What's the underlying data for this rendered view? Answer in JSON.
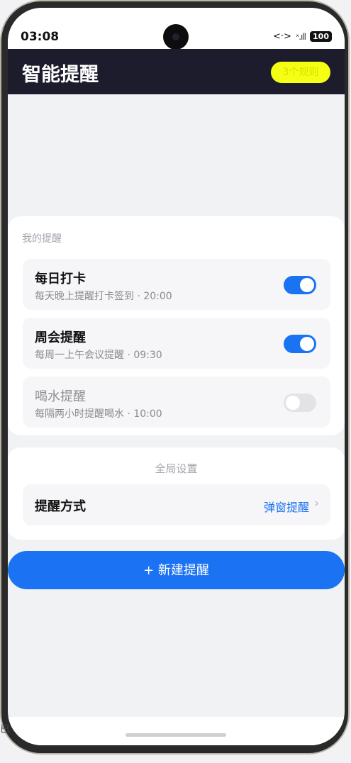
{
  "status": {
    "time": "03:08",
    "network_icon": "<·>",
    "signal": "ˣ.ıll",
    "battery": "100"
  },
  "header": {
    "title": "智能提醒",
    "rules_badge": "3个规则"
  },
  "reminders": {
    "section_label": "我的提醒",
    "items": [
      {
        "name": "每日打卡",
        "desc": "每天晚上提醒打卡签到 · 20:00",
        "enabled": true
      },
      {
        "name": "周会提醒",
        "desc": "每周一上午会议提醒 · 09:30",
        "enabled": true
      },
      {
        "name": "喝水提醒",
        "desc": "每隔两小时提醒喝水 · 10:00",
        "enabled": false
      }
    ]
  },
  "global_settings": {
    "label": "全局设置",
    "method_label": "提醒方式",
    "method_value": "弹窗提醒",
    "chevron": "›"
  },
  "actions": {
    "new_reminder": "+ 新建提醒"
  },
  "colors": {
    "accent": "#1b72f3",
    "header_bg": "#1c1c2c",
    "badge_bg": "#f5ff14"
  },
  "edge_char": "已"
}
